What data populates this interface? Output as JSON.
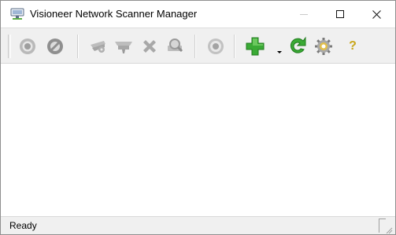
{
  "window": {
    "title": "Visioneer Network Scanner Manager",
    "icon": "scanner-network-icon"
  },
  "window_controls": {
    "minimize_icon": "minimize-icon",
    "maximize_icon": "maximize-icon",
    "close_icon": "close-icon",
    "close_glyph": "✕"
  },
  "toolbar": {
    "buttons": [
      {
        "name": "connect",
        "icon": "disc-icon",
        "enabled": false
      },
      {
        "name": "disconnect",
        "icon": "no-entry-icon",
        "enabled": false
      },
      {
        "name": "scan-settings",
        "icon": "scanner-tool-icon",
        "enabled": false
      },
      {
        "name": "scan-button-config",
        "icon": "scanner-tray-icon",
        "enabled": false
      },
      {
        "name": "delete",
        "icon": "x-delete-icon",
        "enabled": false
      },
      {
        "name": "find-scanner",
        "icon": "magnifier-icon",
        "enabled": false
      },
      {
        "name": "properties",
        "icon": "settings-disc-icon",
        "enabled": false
      },
      {
        "name": "add-scanner",
        "icon": "green-plus-icon",
        "enabled": true
      },
      {
        "name": "refresh",
        "icon": "green-refresh-icon",
        "enabled": true
      },
      {
        "name": "preferences",
        "icon": "gear-icon",
        "enabled": true
      },
      {
        "name": "help",
        "icon": "help-icon",
        "enabled": true
      }
    ],
    "help_label": "?"
  },
  "colors": {
    "disabled_icon": "#9a9a9a",
    "green": "#3aaa35",
    "help": "#c9a71c"
  },
  "status": {
    "text": "Ready"
  }
}
